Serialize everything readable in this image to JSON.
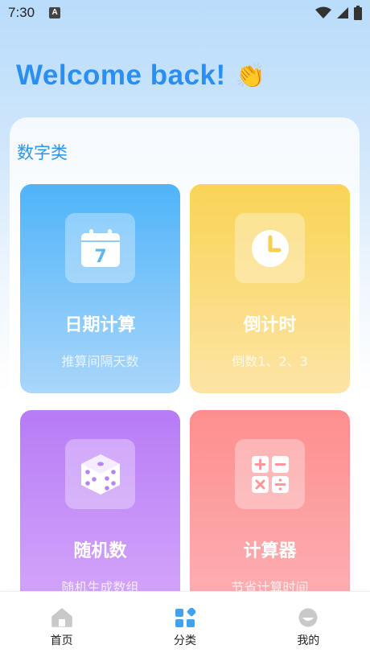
{
  "status_bar": {
    "time": "7:30",
    "notification_badge": "A",
    "icons": [
      "wifi-icon",
      "signal-icon",
      "battery-icon"
    ]
  },
  "header": {
    "welcome": "Welcome back!",
    "emoji": "👏"
  },
  "section": {
    "title": "数字类"
  },
  "cards": [
    {
      "title": "日期计算",
      "subtitle": "推算间隔天数",
      "icon": "calendar-icon",
      "calendar_day": "7",
      "color": "#4fb4f9"
    },
    {
      "title": "倒计时",
      "subtitle": "倒数1、2、3",
      "icon": "clock-icon",
      "color": "#f9d455"
    },
    {
      "title": "随机数",
      "subtitle": "随机生成数组",
      "icon": "dice-icon",
      "color": "#b77bf5"
    },
    {
      "title": "计算器",
      "subtitle": "节省计算时间",
      "icon": "calculator-icon",
      "color": "#fd8e8e"
    }
  ],
  "tabs": [
    {
      "label": "首页",
      "icon": "home-icon",
      "active": false
    },
    {
      "label": "分类",
      "icon": "category-icon",
      "active": true
    },
    {
      "label": "我的",
      "icon": "profile-icon",
      "active": false
    }
  ],
  "colors": {
    "accent": "#2a8ff0",
    "section_title": "#2e93ea",
    "tab_active": "#3fa3f2",
    "tab_inactive": "#cccccc"
  }
}
